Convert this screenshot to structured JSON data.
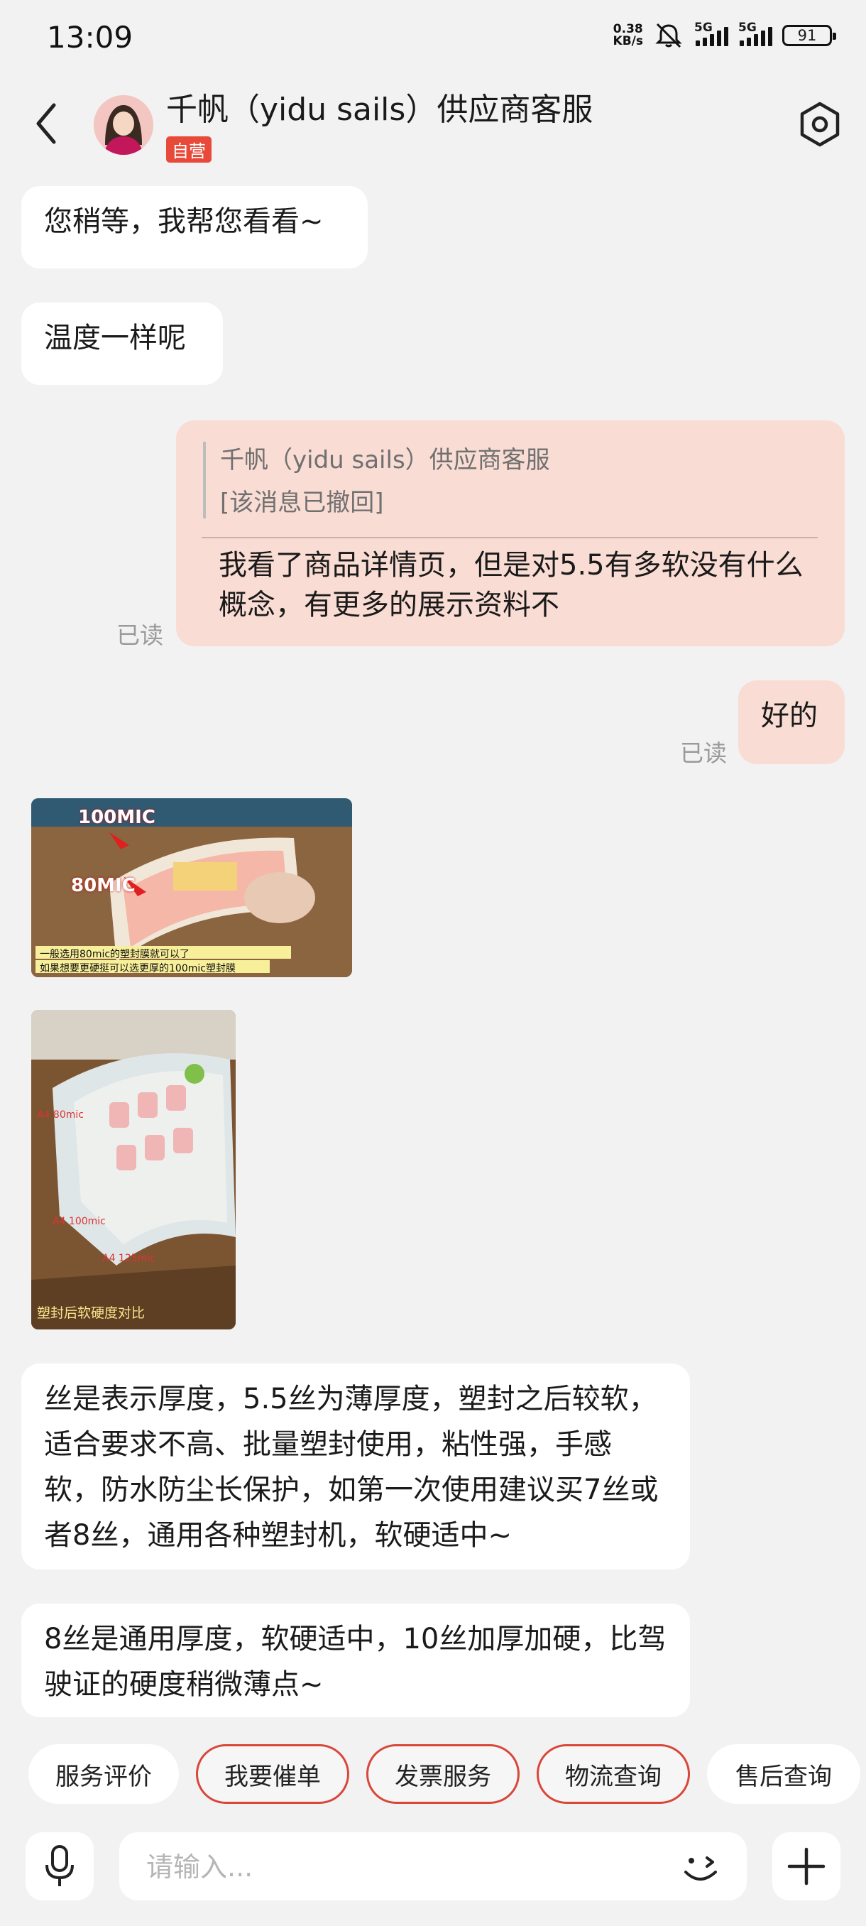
{
  "status": {
    "time": "13:09",
    "net_speed_value": "0.38",
    "net_speed_unit": "KB/s",
    "sim1": "5G",
    "sim2": "5G",
    "battery": "91"
  },
  "header": {
    "title": "千帆（yidu sails）供应商客服",
    "badge": "自营"
  },
  "messages": {
    "m1": "您稍等，我帮您看看~",
    "m2": "温度一样呢",
    "quote_name": "千帆（yidu sails）供应商客服",
    "quote_text": "[该消息已撤回]",
    "m3": "我看了商品详情页，但是对5.5有多软没有什么概念，有更多的展示资料不",
    "m3_status": "已读",
    "m4": "好的",
    "m4_status": "已读",
    "img1_label_a": "100MIC",
    "img1_label_b": "80MIC",
    "img1_caption_1": "一般选用80mic的塑封膜就可以了",
    "img1_caption_2": "如果想要更硬挺可以选更厚的100mic塑封膜",
    "img2_caption": "塑封后软硬度对比",
    "img2_label_1": "A4 80mic",
    "img2_label_2": "A4 100mic",
    "img2_label_3": "A4 125mic",
    "m5": "丝是表示厚度，5.5丝为薄厚度，塑封之后较软，适合要求不高、批量塑封使用，粘性强，手感软，防水防尘长保护，如第一次使用建议买7丝或者8丝，通用各种塑封机，软硬适中~",
    "m6": "8丝是通用厚度，软硬适中，10丝加厚加硬，比驾驶证的硬度稍微薄点~"
  },
  "quick_actions": [
    "服务评价",
    "我要催单",
    "发票服务",
    "物流查询",
    "售后查询"
  ],
  "input": {
    "placeholder": "请输入..."
  },
  "colors": {
    "accent": "#d9463a",
    "my_bubble": "#f9dcd3",
    "badge": "#e84a3a"
  }
}
